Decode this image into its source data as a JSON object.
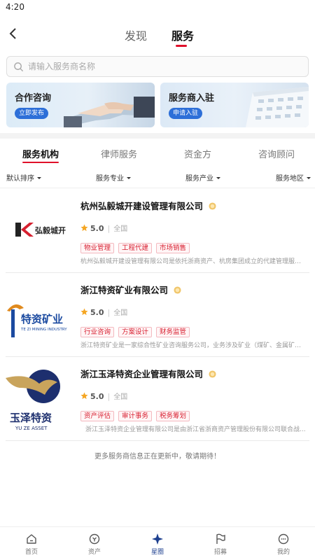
{
  "status_bar": {
    "time": "4:20"
  },
  "topnav": {
    "tabs": [
      "发现",
      "服务"
    ],
    "active": "服务"
  },
  "search": {
    "placeholder": "请输入服务商名称",
    "value": ""
  },
  "banners": [
    {
      "title": "合作咨询",
      "button": "立即发布"
    },
    {
      "title": "服务商入驻",
      "button": "申请入驻"
    }
  ],
  "category_tabs": [
    "服务机构",
    "律师服务",
    "资金方",
    "咨询顾问"
  ],
  "active_category": "服务机构",
  "filters": [
    "默认排序",
    "服务专业",
    "服务产业",
    "服务地区"
  ],
  "providers": [
    {
      "name": "杭州弘毅城开建设管理有限公司",
      "logo_text": "弘毅城开",
      "rating": "5.0",
      "region": "全国",
      "tags": [
        "物业管理",
        "工程代建",
        "市场销售"
      ],
      "desc": "杭州弘毅城开建设管理有限公司是依托浙商资产、杭房集团成立的代建管理服务..."
    },
    {
      "name": "浙江特资矿业有限公司",
      "logo_text": "特资矿业",
      "logo_subtext": "TE ZI MINING INDUSTRY",
      "rating": "5.0",
      "region": "全国",
      "tags": [
        "行业咨询",
        "方案设计",
        "财务监管"
      ],
      "desc": "浙江特资矿业是一家综合性矿业咨询服务公司，业务涉及矿业（煤矿、金属矿、..."
    },
    {
      "name": "浙江玉泽特资企业管理有限公司",
      "logo_text": "玉泽特资",
      "logo_subtext": "YU ZE ASSET",
      "rating": "5.0",
      "region": "全国",
      "tags": [
        "资产评估",
        "审计事务",
        "税务筹划"
      ],
      "desc": "浙江玉泽特资企业管理有限公司是由浙江省浙商资产管理股份有限公司联合战..."
    }
  ],
  "more_note": "更多服务商信息正在更新中，敬请期待！",
  "bottom_nav": [
    {
      "label": "首页",
      "icon": "home-icon"
    },
    {
      "label": "资产",
      "icon": "asset-icon"
    },
    {
      "label": "星圈",
      "icon": "star-circle-icon",
      "active": true
    },
    {
      "label": "招募",
      "icon": "flag-icon"
    },
    {
      "label": "我的",
      "icon": "profile-icon"
    }
  ],
  "colors": {
    "accent": "#e0102a",
    "tag_text": "#d81f30",
    "active_nav": "#1d3f8f",
    "button_blue": "#2d6fd8",
    "star": "#f5a623"
  }
}
